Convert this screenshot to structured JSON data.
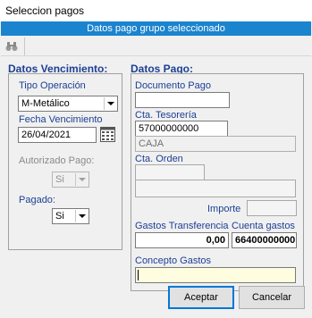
{
  "window": {
    "title": "Seleccion pagos"
  },
  "banner": "Datos pago grupo seleccionado",
  "toolbar": {
    "search_icon": "binoculars-icon"
  },
  "vencimiento": {
    "title": "Datos Vencimiento:",
    "tipo_label": "Tipo Operación",
    "tipo_value": "M-Metálico",
    "fecha_label": "Fecha Vencimiento",
    "fecha_value": "26/04/2021",
    "autorizado_label": "Autorizado Pago:",
    "autorizado_value": "Si",
    "pagado_label": "Pagado:",
    "pagado_value": "Si"
  },
  "pago": {
    "title": "Datos Pago:",
    "documento_label": "Documento Pago",
    "documento_value": "",
    "tesoreria_label": "Cta. Tesorería",
    "tesoreria_value": "57000000000",
    "tesoreria_desc": "CAJA",
    "orden_label": "Cta. Orden",
    "orden_value": "",
    "orden_desc": "",
    "importe_label": "Importe",
    "importe_value": "",
    "gastos_label": "Gastos Transferencia",
    "gastos_value": "0,00",
    "cuenta_gastos_label": "Cuenta gastos",
    "cuenta_gastos_value": "66400000000",
    "concepto_label": "Concepto Gastos",
    "concepto_value": ""
  },
  "buttons": {
    "accept": "Aceptar",
    "cancel": "Cancelar"
  },
  "colors": {
    "banner": "#1b84cf",
    "label": "#1c3f95",
    "concepto_bg": "#fffde0"
  }
}
